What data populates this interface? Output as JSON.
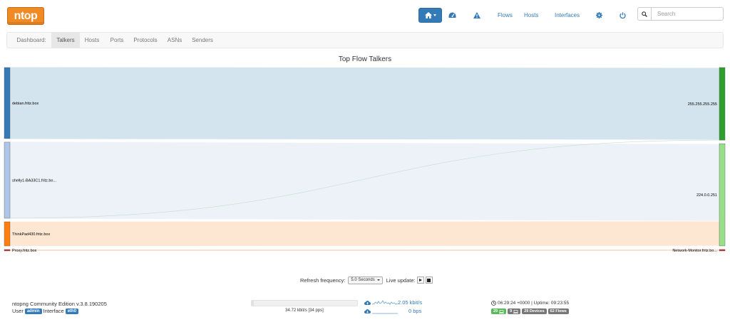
{
  "app": {
    "logo": "ntop"
  },
  "nav": {
    "flows": "Flows",
    "hosts": "Hosts",
    "interfaces": "Interfaces",
    "search_placeholder": "Search"
  },
  "tabs": {
    "dashboard": "Dashboard:",
    "items": [
      "Talkers",
      "Hosts",
      "Ports",
      "Protocols",
      "ASNs",
      "Senders"
    ],
    "active": "Talkers"
  },
  "chart_title": "Top Flow Talkers",
  "chart_data": {
    "type": "sankey",
    "sources": [
      {
        "name": "debian.fritz.box",
        "color": "#337ab7",
        "link_color": "#d3e4ef"
      },
      {
        "name": "shelly1-BA33C1.fritz.bo...",
        "color": "#aec7e8",
        "link_color": "#ecf2f8"
      },
      {
        "name": "ThinkPad430.fritz.box",
        "color": "#ff7f0e",
        "link_color": "#fde6d2"
      },
      {
        "name": "Proxy.fritz.box",
        "color": "#d62728",
        "link_color": "#fbe0d0"
      }
    ],
    "targets": [
      {
        "name": "255.255.255.255",
        "color": "#2ca02c"
      },
      {
        "name": "224.0.0.251",
        "color": "#98df8a"
      },
      {
        "name": "Network-Monitor.fritz.bo...",
        "color": "#d62728"
      }
    ],
    "links": [
      {
        "source": 0,
        "target": 0,
        "value": 100
      },
      {
        "source": 1,
        "target": 1,
        "value": 107
      },
      {
        "source": 2,
        "target": 1,
        "value": 34
      },
      {
        "source": 3,
        "target": 2,
        "value": 2
      },
      {
        "source": 1,
        "target": 0,
        "value": 0.1
      }
    ]
  },
  "refresh": {
    "label": "Refresh frequency:",
    "frequency": "5.0 Seconds",
    "live_label": "Live update:"
  },
  "footer": {
    "version": "ntopng Community Edition v.3.8.190205",
    "user_label": "User",
    "user": "admin",
    "interface_label": "Interface",
    "interface": "eth0",
    "load_text": "34.72 kbit/s [34 pps]",
    "load_fraction": 0.02,
    "upload": "2.05 kbit/s",
    "download": "0 bps",
    "uptime": "06:29:24 +0000 | Uptime: 09:23:55",
    "badges": {
      "alerts": "29",
      "hosts": "9",
      "devices": "29 Devices",
      "flows": "62 Flows"
    }
  }
}
